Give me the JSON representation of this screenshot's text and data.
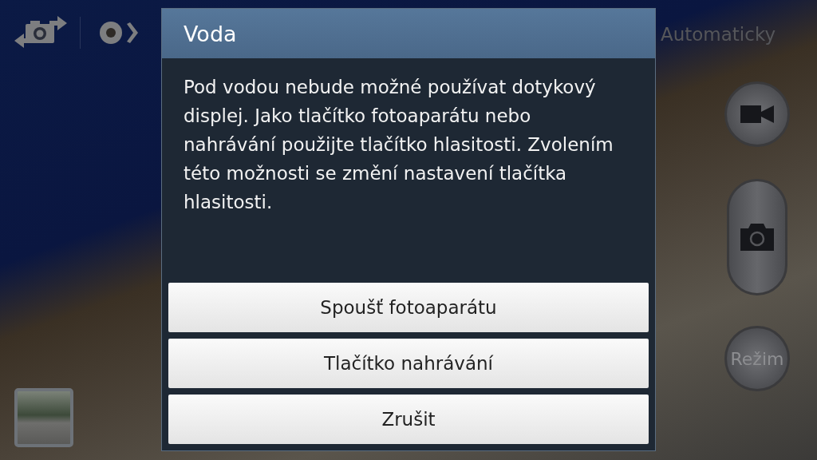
{
  "camera": {
    "scene_mode": "Automaticky",
    "mode_button": "Režim"
  },
  "dialog": {
    "title": "Voda",
    "message": "Pod vodou nebude možné používat dotykový displej. Jako tlačítko fotoaparátu nebo nahrávání použijte tlačítko hlasitosti. Zvolením této možnosti se změní nastavení tlačítka hlasitosti.",
    "buttons": [
      "Spoušť fotoaparátu",
      "Tlačítko nahrávání",
      "Zrušit"
    ]
  }
}
